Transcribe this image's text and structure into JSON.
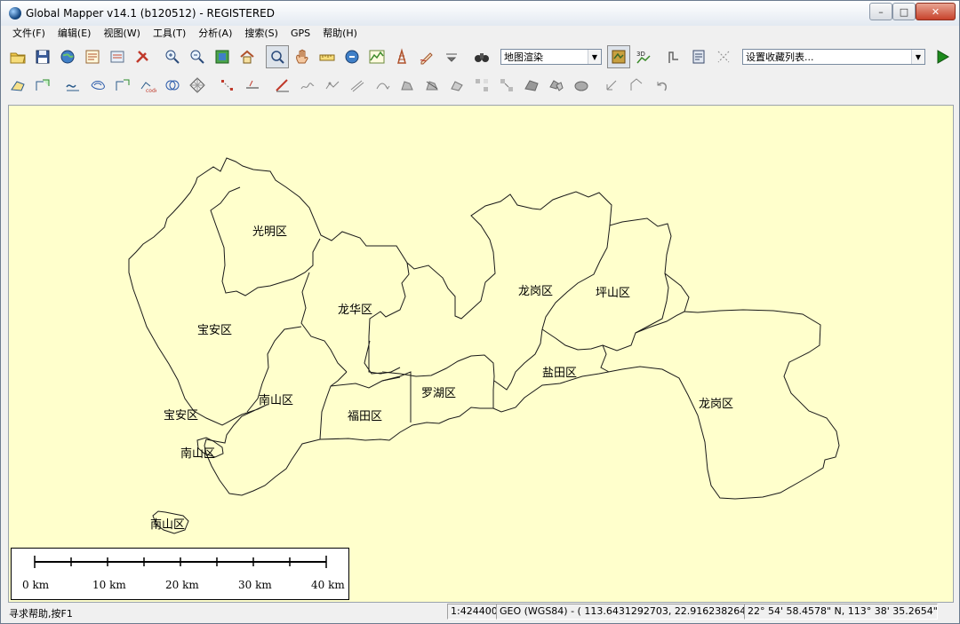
{
  "window": {
    "title": "Global Mapper v14.1 (b120512) - REGISTERED",
    "minimize": "–",
    "maximize": "□",
    "close": "✕"
  },
  "menu": [
    "文件(F)",
    "编辑(E)",
    "视图(W)",
    "工具(T)",
    "分析(A)",
    "搜索(S)",
    "GPS",
    "帮助(H)"
  ],
  "toolbar": {
    "render_mode_value": "地图渲染",
    "favorites_value": "设置收藏列表...",
    "go_icon": "play-icon",
    "colors": {
      "accent": "#1c8a1c",
      "map_bg": "#ffffcc"
    }
  },
  "map": {
    "labels": {
      "guangming": "光明区",
      "baoan_main": "宝安区",
      "longhua": "龙华区",
      "longgang_north": "龙岗区",
      "pingshan": "坪山区",
      "nanshan_main": "南山区",
      "baoan_coast": "宝安区",
      "futian": "福田区",
      "luohu": "罗湖区",
      "yantian": "盐田区",
      "longgang_east": "龙岗区",
      "nanshan_island1": "南山区",
      "nanshan_island2": "南山区"
    },
    "scalebar": {
      "ticks": [
        "0 km",
        "10 km",
        "20 km",
        "30 km",
        "40 km"
      ]
    }
  },
  "status": {
    "help": "寻求帮助,按F1",
    "scale": "1:424400",
    "coords": "GEO (WGS84) - ( 113.6431292703, 22.9162382645 )",
    "dms": "22° 54' 58.4578\" N, 113° 38' 35.2654\" E"
  }
}
